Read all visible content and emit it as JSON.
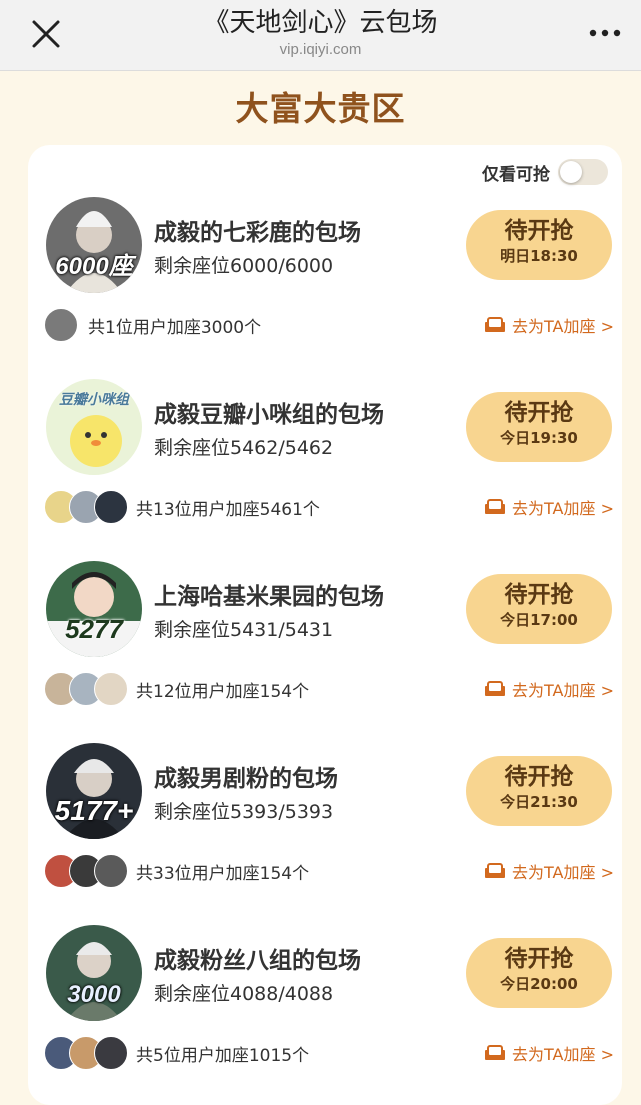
{
  "header": {
    "title": "《天地剑心》云包场",
    "url": "vip.iqiyi.com"
  },
  "section_title": "大富大贵区",
  "filter": {
    "label": "仅看可抢",
    "enabled": false
  },
  "join_link_label": "去为TA加座 >",
  "items": [
    {
      "name": "成毅的七彩鹿的包场",
      "seats": "剩余座位6000/6000",
      "button_label": "待开抢",
      "button_time": "明日18:30",
      "footer": "共1位用户加座3000个",
      "avatar_text": "6000座",
      "mini_count": 1
    },
    {
      "name": "成毅豆瓣小咪组的包场",
      "seats": "剩余座位5462/5462",
      "button_label": "待开抢",
      "button_time": "今日19:30",
      "footer": "共13位用户加座5461个",
      "avatar_text": "豆瓣小咪组",
      "mini_count": 3
    },
    {
      "name": "上海哈基米果园的包场",
      "seats": "剩余座位5431/5431",
      "button_label": "待开抢",
      "button_time": "今日17:00",
      "footer": "共12位用户加座154个",
      "avatar_text": "5277",
      "mini_count": 3
    },
    {
      "name": "成毅男剧粉的包场",
      "seats": "剩余座位5393/5393",
      "button_label": "待开抢",
      "button_time": "今日21:30",
      "footer": "共33位用户加座154个",
      "avatar_text": "5177+",
      "mini_count": 3
    },
    {
      "name": "成毅粉丝八组的包场",
      "seats": "剩余座位4088/4088",
      "button_label": "待开抢",
      "button_time": "今日20:00",
      "footer": "共5位用户加座1015个",
      "avatar_text": "3000",
      "mini_count": 3
    }
  ],
  "icons": {
    "close": "close-icon",
    "more": "more-dots-icon",
    "join": "sofa-icon"
  },
  "colors": {
    "page_bg": "#fdf7e8",
    "section_title": "#8f521d",
    "button_bg": "#f8d590",
    "button_text": "#5a3913",
    "link": "#d2691e"
  }
}
